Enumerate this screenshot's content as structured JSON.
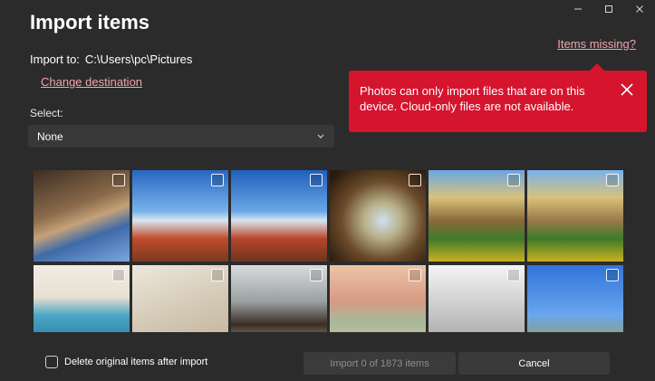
{
  "window": {
    "title": "Import items"
  },
  "import_to": {
    "label": "Import to:",
    "path": "C:\\Users\\pc\\Pictures",
    "change_link": "Change destination"
  },
  "items_missing_link": "Items missing?",
  "select": {
    "label": "Select:",
    "value": "None"
  },
  "tooltip": {
    "message": "Photos can only import files that are on this device. Cloud-only files are not available.",
    "bg_color": "#d5142e"
  },
  "thumbnails": [
    {
      "icon": "photo-thumbnail",
      "checked": false
    },
    {
      "icon": "photo-thumbnail",
      "checked": false
    },
    {
      "icon": "photo-thumbnail",
      "checked": false
    },
    {
      "icon": "photo-thumbnail",
      "checked": false
    },
    {
      "icon": "photo-thumbnail",
      "checked": false
    },
    {
      "icon": "photo-thumbnail",
      "checked": false
    },
    {
      "icon": "photo-thumbnail",
      "checked": false
    },
    {
      "icon": "photo-thumbnail",
      "checked": false
    },
    {
      "icon": "photo-thumbnail",
      "checked": false
    },
    {
      "icon": "photo-thumbnail",
      "checked": false
    },
    {
      "icon": "photo-thumbnail",
      "checked": false
    },
    {
      "icon": "photo-thumbnail",
      "checked": false
    }
  ],
  "footer": {
    "delete_label": "Delete original items after import",
    "import_button": "Import 0 of 1873 items",
    "cancel_button": "Cancel"
  },
  "colors": {
    "background": "#2b2b2b",
    "link": "#f1a3b0",
    "accent_red": "#d5142e"
  }
}
